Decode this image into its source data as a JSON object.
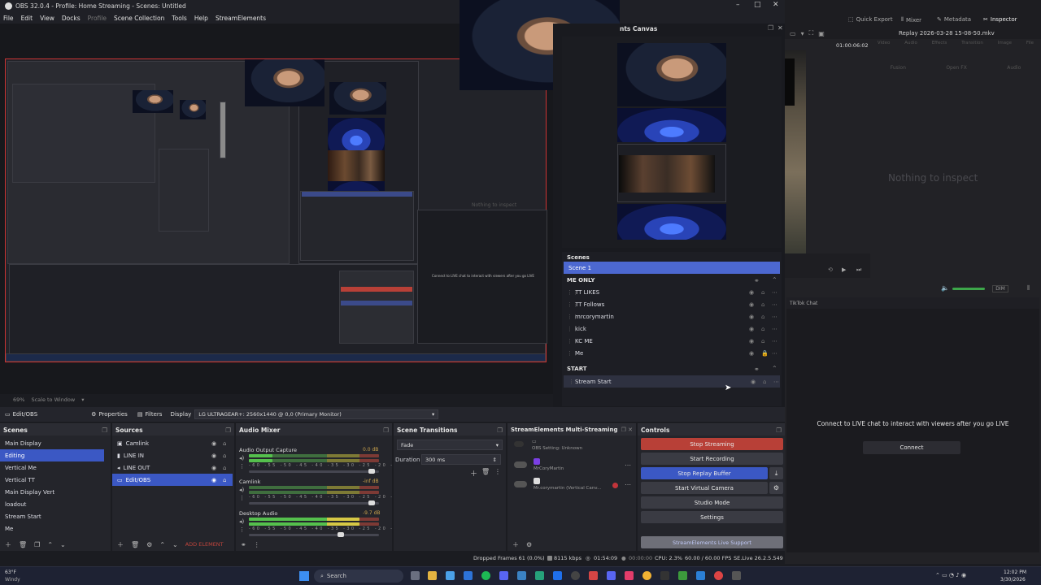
{
  "window": {
    "title": "OBS 32.0.4 - Profile: Home Streaming - Scenes: Untitled",
    "controls": [
      "–",
      "□",
      "✕"
    ]
  },
  "menu": {
    "items": [
      "File",
      "Edit",
      "View",
      "Docks",
      "Profile",
      "Scene Collection",
      "Tools",
      "Help",
      "StreamElements"
    ]
  },
  "preview": {
    "empty_text": "Nothing to inspect",
    "nested_chat": "Connect to LIVE chat to interact with viewers after you go LIVE",
    "zoom": "69%",
    "scale_label": "Scale to Window"
  },
  "canvas_dock": {
    "title": "nts Canvas"
  },
  "inner_scenes": {
    "header": "Scenes",
    "selected": "Scene 1",
    "groups": [
      {
        "name": "ME ONLY",
        "items": [
          "TT LIKES",
          "TT Follows",
          "mrcorymartin",
          "kick",
          "KC ME",
          "Me"
        ]
      },
      {
        "name": "START",
        "items": [
          "Stream Start"
        ]
      }
    ]
  },
  "toolbar": {
    "source_name": "Edit/OBS",
    "properties": "Properties",
    "filters": "Filters",
    "display_label": "Display",
    "display_value": "LG ULTRAGEAR+: 2560x1440 @ 0,0 (Primary Monitor)"
  },
  "scenes_dock": {
    "title": "Scenes",
    "items": [
      "Main Display",
      "Editing",
      "Vertical Me",
      "Vertical TT",
      "Main Display Vert",
      "loadout",
      "Stream Start",
      "Me"
    ],
    "selected_index": 1
  },
  "sources_dock": {
    "title": "Sources",
    "items": [
      "Camlink",
      "LINE IN",
      "LINE OUT",
      "Edit/OBS"
    ],
    "selected_index": 3,
    "add_element": "ADD ELEMENT"
  },
  "audio_mixer": {
    "title": "Audio Mixer",
    "channels": [
      {
        "name": "Audio Output Capture",
        "db": "0.0 dB",
        "level": 0.18
      },
      {
        "name": "Camlink",
        "db": "-inf dB",
        "level": 0.0
      },
      {
        "name": "Desktop Audio",
        "db": "-9.7 dB",
        "level": 0.85
      }
    ],
    "scale_labels": "-60 -55 -50 -45 -40 -35 -30 -25 -20 -15 -10 -5 0"
  },
  "transitions": {
    "title": "Scene Transitions",
    "type": "Fade",
    "duration_label": "Duration",
    "duration_value": "300 ms"
  },
  "multistream": {
    "title": "StreamElements Multi-Streaming",
    "rows": [
      {
        "label": "OBS Setting: Unknown"
      },
      {
        "label": "MrCoryMartin"
      },
      {
        "label": "Mr.corymartin (Vertical Canv..."
      }
    ]
  },
  "controls": {
    "title": "Controls",
    "stop_streaming": "Stop Streaming",
    "start_recording": "Start Recording",
    "stop_replay": "Stop Replay Buffer",
    "start_virtual": "Start Virtual Camera",
    "studio_mode": "Studio Mode",
    "settings": "Settings",
    "support": "StreamElements Live Support"
  },
  "status": {
    "dropped": "Dropped Frames 61 (0.0%)",
    "bitrate": "8115 kbps",
    "stream_time": "01:54:09",
    "rec_time": "00:00:00",
    "cpu": "CPU: 2.3%",
    "fps": "60.00 / 60.00 FPS",
    "se_version": "SE.Live 26.2.5.549"
  },
  "resolve": {
    "quick_export": "Quick Export",
    "mixer": "Mixer",
    "metadata": "Metadata",
    "inspector": "Inspector",
    "clip_name": "Replay 2026-03-28 15-08-50.mkv",
    "timecode": "01:00:06:02",
    "inspector_empty": "Nothing to inspect",
    "tabs": [
      "Video",
      "Audio",
      "Effects",
      "Transition",
      "Image",
      "File"
    ],
    "sub_tabs": [
      "Fusion",
      "Open FX",
      "Audio"
    ],
    "dim_label": "DIM",
    "chat_title": "TikTok Chat",
    "chat_message": "Connect to LIVE chat to interact with viewers after you go LIVE",
    "connect": "Connect"
  },
  "taskbar": {
    "temp": "63°F",
    "weather": "Windy",
    "search": "Search",
    "time": "12:02 PM",
    "date": "3/30/2026"
  }
}
